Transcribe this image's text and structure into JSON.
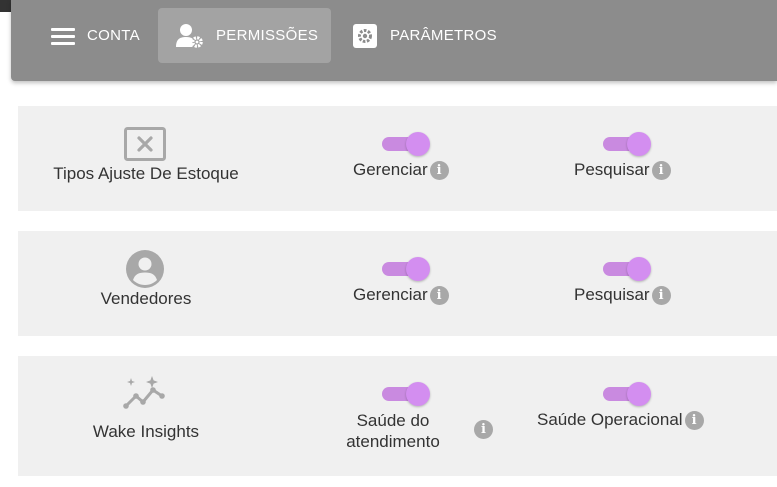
{
  "nav": {
    "tabs": [
      {
        "label": "CONTA",
        "icon": "menu-icon",
        "active": false
      },
      {
        "label": "PERMISSÕES",
        "icon": "user-gear-icon",
        "active": true
      },
      {
        "label": "PARÂMETROS",
        "icon": "gear-icon",
        "active": false
      }
    ]
  },
  "colors": {
    "topbar": "#8c8c8c",
    "active_tab": "#a3a3a3",
    "row_bg": "#f0f0f0",
    "toggle_on": "#d38ef0",
    "info_icon": "#a8a8a8"
  },
  "rows": [
    {
      "label": "Tipos Ajuste De Estoque",
      "icon": "disabled-box-icon",
      "permissions": [
        {
          "label": "Gerenciar",
          "enabled": true
        },
        {
          "label": "Pesquisar",
          "enabled": true
        }
      ]
    },
    {
      "label": "Vendedores",
      "icon": "person-circle-icon",
      "permissions": [
        {
          "label": "Gerenciar",
          "enabled": true
        },
        {
          "label": "Pesquisar",
          "enabled": true
        }
      ]
    },
    {
      "label": "Wake Insights",
      "icon": "sparkle-chart-icon",
      "permissions": [
        {
          "label": "Saúde do atendimento",
          "enabled": true
        },
        {
          "label": "Saúde Operacional",
          "enabled": true
        }
      ]
    }
  ],
  "info_glyph": "i"
}
